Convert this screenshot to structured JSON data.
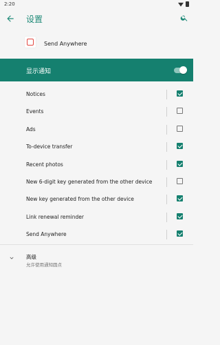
{
  "status": {
    "time": "2:20"
  },
  "appbar": {
    "title": "设置"
  },
  "app": {
    "name": "Send Anywhere"
  },
  "banner": {
    "label": "显示通知",
    "enabled": true
  },
  "items": [
    {
      "label": "Notices",
      "checked": true
    },
    {
      "label": "Events",
      "checked": false
    },
    {
      "label": "Ads",
      "checked": false
    },
    {
      "label": "To-device transfer",
      "checked": true
    },
    {
      "label": "Recent photos",
      "checked": true
    },
    {
      "label": "New 6-digit key generated from the other device",
      "checked": false
    },
    {
      "label": "New key generated from the other device",
      "checked": true
    },
    {
      "label": "Link renewal reminder",
      "checked": true
    },
    {
      "label": "Send Anywhere",
      "checked": true
    }
  ],
  "advanced": {
    "title": "高级",
    "subtitle": "允许使用通知圆点"
  },
  "colors": {
    "accent": "#15806f",
    "title": "#1f8a78"
  }
}
